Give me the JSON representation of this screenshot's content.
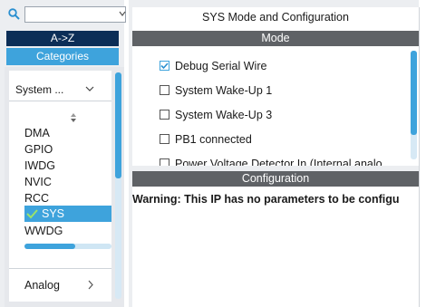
{
  "sidebar": {
    "search": {
      "value": "",
      "placeholder": ""
    },
    "az_label": "A->Z",
    "categories_label": "Categories",
    "group_label": "System ...",
    "items": [
      {
        "label": "DMA"
      },
      {
        "label": "GPIO"
      },
      {
        "label": "IWDG"
      },
      {
        "label": "NVIC"
      },
      {
        "label": "RCC"
      },
      {
        "label": "SYS",
        "selected": true
      },
      {
        "label": "WWDG"
      }
    ],
    "analog_label": "Analog"
  },
  "main": {
    "title": "SYS Mode and Configuration",
    "mode_header": "Mode",
    "mode_options": [
      {
        "label": "Debug Serial Wire",
        "checked": true
      },
      {
        "label": "System Wake-Up 1",
        "checked": false
      },
      {
        "label": "System Wake-Up 3",
        "checked": false
      },
      {
        "label": "PB1 connected",
        "checked": false
      },
      {
        "label": "Power Voltage Detector In (Internal analo",
        "checked": false
      }
    ],
    "config_header": "Configuration",
    "warning": "Warning: This IP has no parameters to be configu"
  },
  "colors": {
    "accent": "#3ea3dc",
    "navy": "#0c2e57",
    "header_gray": "#5f6266"
  }
}
